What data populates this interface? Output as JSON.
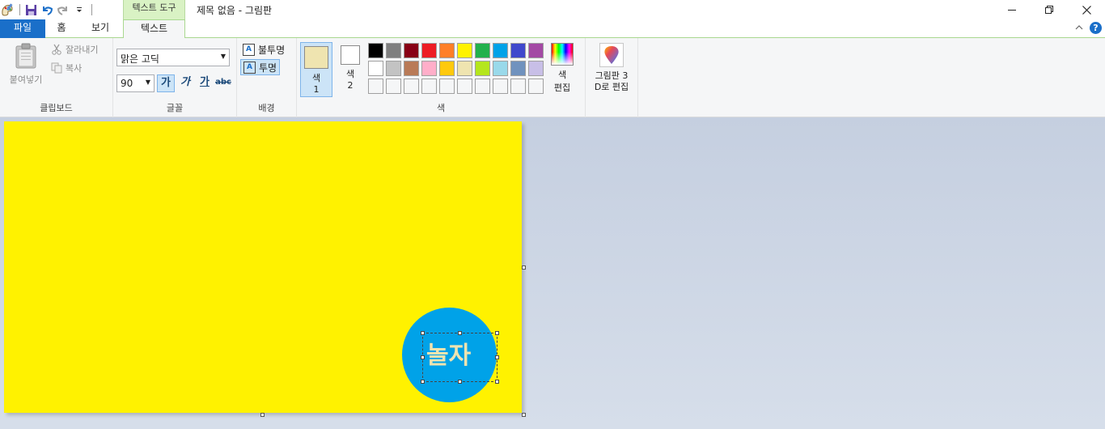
{
  "window": {
    "title": "제목 없음 - 그림판",
    "context_tab_group": "텍스트 도구"
  },
  "tabs": {
    "file": "파일",
    "home": "홈",
    "view": "보기",
    "text": "텍스트"
  },
  "clipboard": {
    "paste": "붙여넣기",
    "cut": "잘라내기",
    "copy": "복사",
    "group_label": "클립보드"
  },
  "font": {
    "family": "맑은 고딕",
    "size": "90",
    "bold": "가",
    "italic": "가",
    "underline": "가",
    "strikethrough": "abc",
    "group_label": "글꼴"
  },
  "background": {
    "opaque": "불투명",
    "transparent": "투명",
    "group_label": "배경"
  },
  "colors": {
    "color1_label": "색",
    "color1_num": "1",
    "color2_label": "색",
    "color2_num": "2",
    "color1_value": "#efe4b0",
    "color2_value": "#ffffff",
    "edit_label_1": "색",
    "edit_label_2": "편집",
    "group_label": "색",
    "palette": [
      "#000000",
      "#7f7f7f",
      "#880015",
      "#ed1c24",
      "#ff7f27",
      "#fff200",
      "#22b14c",
      "#00a2e8",
      "#3f48cc",
      "#a349a4",
      "#ffffff",
      "#c3c3c3",
      "#b97a57",
      "#ffaec9",
      "#ffc90e",
      "#efe4b0",
      "#b5e61d",
      "#99d9ea",
      "#7092be",
      "#c8bfe7",
      "#f5f6f7",
      "#f5f6f7",
      "#f5f6f7",
      "#f5f6f7",
      "#f5f6f7",
      "#f5f6f7",
      "#f5f6f7",
      "#f5f6f7",
      "#f5f6f7",
      "#f5f6f7"
    ]
  },
  "paint3d": {
    "line1": "그림판 3",
    "line2": "D로 편집"
  },
  "canvas": {
    "background_color": "#fff200",
    "circle_color": "#00a2e8",
    "text": "놀자",
    "text_color": "#efe4b0"
  }
}
